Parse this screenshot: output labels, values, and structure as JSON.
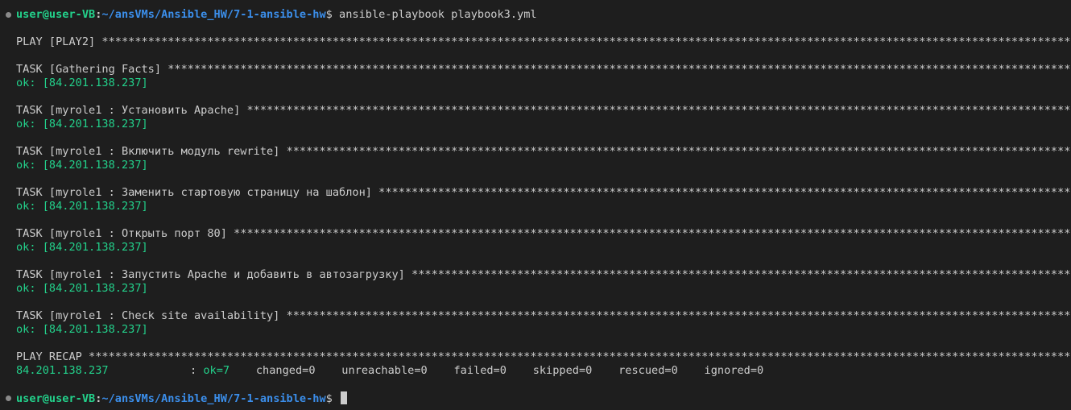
{
  "prompt": {
    "user_host": "user@user-VB",
    "separator": ":",
    "path": "~/ansVMs/Ansible_HW/7-1-ansible-hw",
    "dollar": "$"
  },
  "command": "ansible-playbook playbook3.yml",
  "play_header": "PLAY [PLAY2]",
  "tasks": [
    {
      "header": "TASK [Gathering Facts]",
      "result": "ok: [84.201.138.237]"
    },
    {
      "header": "TASK [myrole1 : Установить Apache]",
      "result": "ok: [84.201.138.237]"
    },
    {
      "header": "TASK [myrole1 : Включить модуль rewrite]",
      "result": "ok: [84.201.138.237]"
    },
    {
      "header": "TASK [myrole1 : Заменить стартовую страницу на шаблон]",
      "result": "ok: [84.201.138.237]"
    },
    {
      "header": "TASK [myrole1 : Открыть порт 80]",
      "result": "ok: [84.201.138.237]"
    },
    {
      "header": "TASK [myrole1 : Запустить Apache и добавить в автозагрузку]",
      "result": "ok: [84.201.138.237]"
    },
    {
      "header": "TASK [myrole1 : Check site availability]",
      "result": "ok: [84.201.138.237]"
    }
  ],
  "recap": {
    "header": "PLAY RECAP",
    "host": "84.201.138.237",
    "colon": ":",
    "ok": "ok=7",
    "changed": "changed=0",
    "unreachable": "unreachable=0",
    "failed": "failed=0",
    "skipped": "skipped=0",
    "rescued": "rescued=0",
    "ignored": "ignored=0"
  },
  "colors": {
    "background": "#1e1e1e",
    "text": "#cccccc",
    "ok_green": "#23d18b",
    "path_blue": "#3b8eea"
  }
}
